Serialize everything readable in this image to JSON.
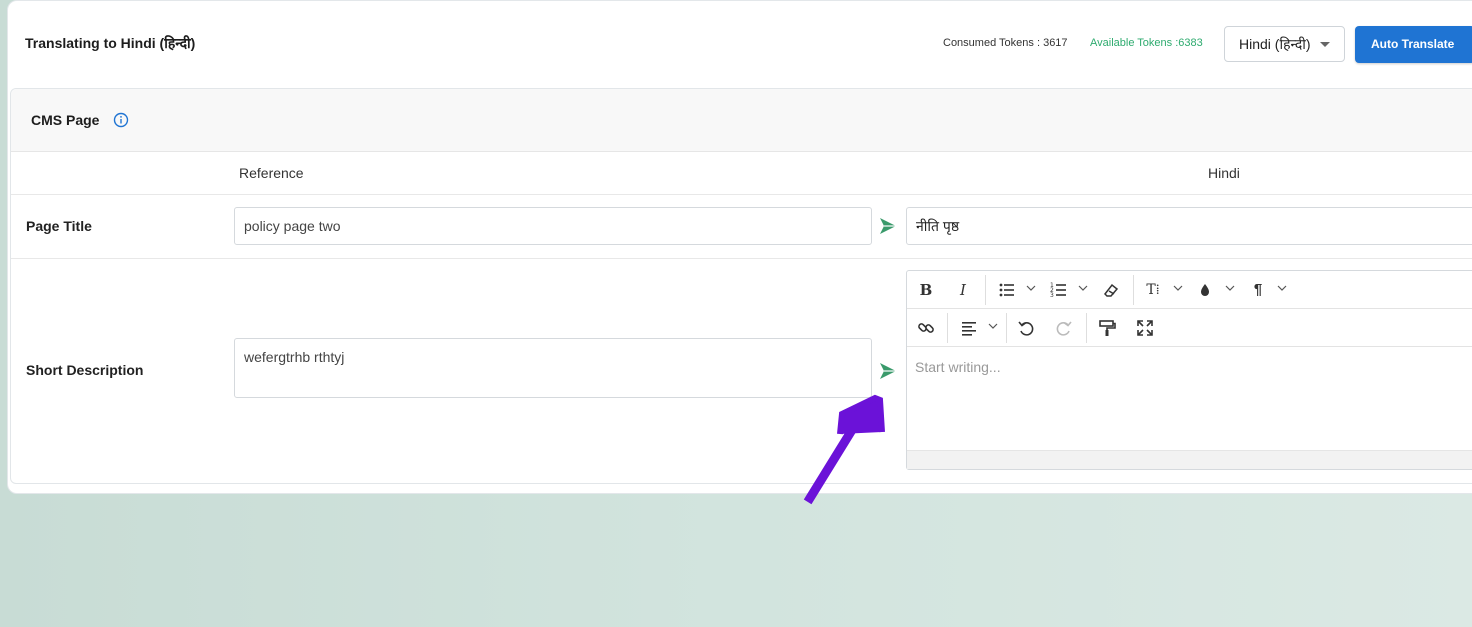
{
  "header": {
    "title": "Translating to Hindi (हिन्दी)",
    "consumed_tokens": "Consumed Tokens : 3617",
    "available_tokens": "Available Tokens :6383",
    "language_select": "Hindi (हिन्दी)",
    "auto_translate_label": "Auto Translate"
  },
  "panel": {
    "title": "CMS Page",
    "columns": {
      "reference": "Reference",
      "target": "Hindi"
    },
    "rows": [
      {
        "label": "Page Title",
        "reference_value": "policy page two",
        "target_value": "नीति पृष्ठ"
      },
      {
        "label": "Short Description",
        "reference_value": "wefergtrhb rthtyj",
        "target_placeholder": "Start writing..."
      }
    ]
  },
  "editor_toolbar": {
    "row1": [
      "bold-icon",
      "italic-icon",
      "bulleted-list-icon",
      "numbered-list-icon",
      "remove-format-icon",
      "text-size-icon",
      "text-color-icon",
      "paragraph-icon"
    ],
    "row2": [
      "link-icon",
      "align-icon",
      "undo-icon",
      "redo-icon",
      "paint-format-icon",
      "fullscreen-icon"
    ]
  },
  "colors": {
    "accent": "#1f74d3",
    "available_tokens": "#2eab6f",
    "send_icon": "#3a9a6b",
    "annotation_arrow": "#6b12d8"
  }
}
